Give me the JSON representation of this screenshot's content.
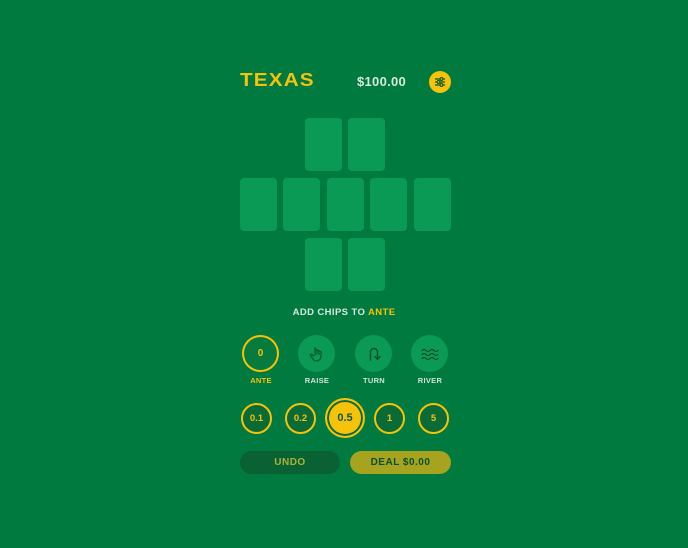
{
  "header": {
    "title": "TEXAS",
    "balance": "$100.00",
    "settings_icon": "sliders-icon"
  },
  "prompt": {
    "prefix": "ADD CHIPS TO",
    "target": "ANTE"
  },
  "spots": [
    {
      "label": "ANTE",
      "value": "0",
      "icon": null,
      "active": true
    },
    {
      "label": "RAISE",
      "icon": "hand-pointer-icon",
      "active": false
    },
    {
      "label": "TURN",
      "icon": "u-turn-arrow-icon",
      "active": false
    },
    {
      "label": "RIVER",
      "icon": "waves-icon",
      "active": false
    }
  ],
  "chips": [
    {
      "value": "0.1",
      "selected": false
    },
    {
      "value": "0.2",
      "selected": false
    },
    {
      "value": "0.5",
      "selected": true
    },
    {
      "value": "1",
      "selected": false
    },
    {
      "value": "5",
      "selected": false
    }
  ],
  "actions": {
    "undo_label": "UNDO",
    "deal_label": "DEAL $0.00"
  },
  "colors": {
    "background": "#007a3f",
    "accent": "#f6c20a",
    "card": "#0a9a55"
  }
}
